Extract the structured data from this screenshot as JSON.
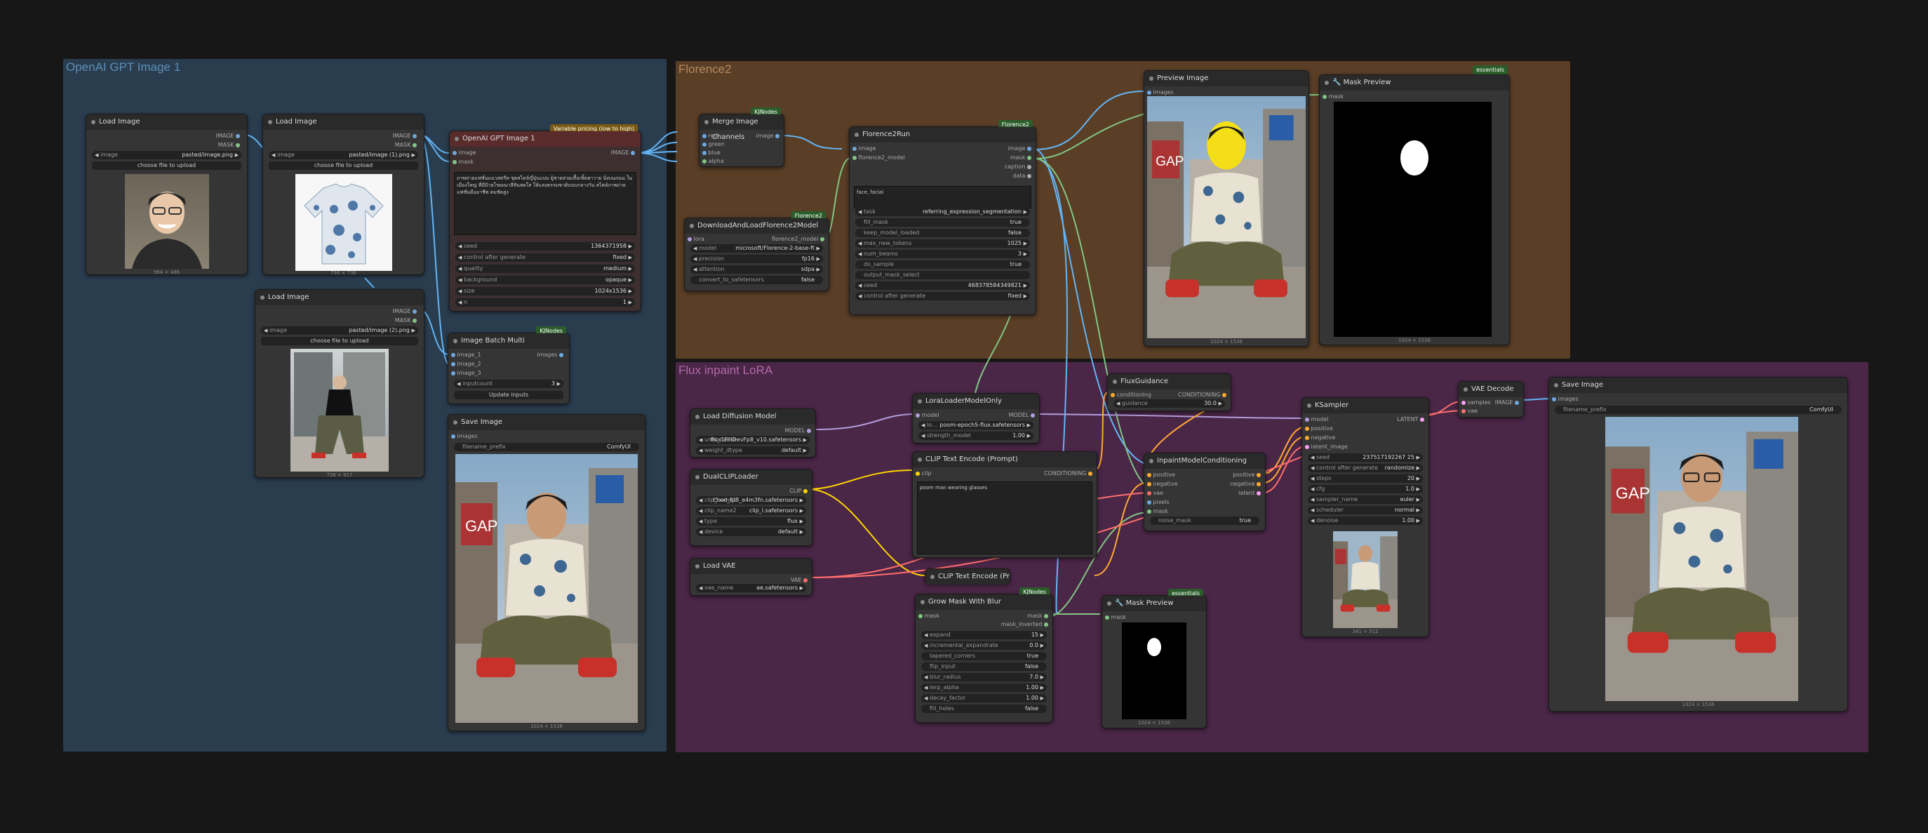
{
  "groups": {
    "openai": "OpenAI GPT Image 1",
    "florence": "Florence2",
    "flux": "Flux inpaint LoRA"
  },
  "colors": {
    "group_openai": "#2a3d4f",
    "group_florence": "#5a3e26",
    "group_flux": "#4a2647",
    "wire_image": "#64b5f6",
    "wire_mask": "#81c784",
    "wire_clip": "#ffd500",
    "wire_conditioning": "#ffa931",
    "wire_vae": "#ff6e6e",
    "wire_model": "#b39ddb"
  },
  "badges": {
    "kjnodes": "KJNodes",
    "florence2": "Florence2",
    "essentials": "essentials",
    "pricing": "Variable pricing (low to high)"
  },
  "load1": {
    "title": "Load Image",
    "out_image": "IMAGE",
    "out_mask": "MASK",
    "image_label": "image",
    "image_value": "pasted/image.png",
    "upload": "choose file to upload",
    "dims": "964 × 486"
  },
  "load2": {
    "title": "Load Image",
    "out_image": "IMAGE",
    "out_mask": "MASK",
    "image_label": "image",
    "image_value": "pasted/image (1).png",
    "upload": "choose file to upload",
    "dims": "736 × 736"
  },
  "load3": {
    "title": "Load Image",
    "out_image": "IMAGE",
    "out_mask": "MASK",
    "image_label": "image",
    "image_value": "pasted/image (2).png",
    "upload": "choose file to upload",
    "dims": "736 × 917"
  },
  "gpt": {
    "title": "OpenAI GPT Image 1",
    "in_image": "image",
    "in_mask": "mask",
    "out_image": "IMAGE",
    "prompt": "ภาพถ่ายแฟชั่นแนวสตรีท ชุดสไตล์ญี่ปุ่นแบบ ผู้ชายสวมเสื้อเชิ้ตฮาวาย นั่งบนถนน ในเมืองใหญ่ ที่มีป้ายโฆษณาสีสันสดใส ให้แสงธรรมชาติแบบกลางวัน สไตล์ภาพถ่ายแฟชั่นมืออาชีพ คมชัดสูง",
    "seed_label": "seed",
    "seed": "1364371958",
    "cag_label": "control after generate",
    "cag": "fixed",
    "quality_label": "quality",
    "quality": "medium",
    "bg_label": "background",
    "bg": "opaque",
    "size_label": "size",
    "size": "1024x1536",
    "n_label": "n",
    "n": "1"
  },
  "batch": {
    "title": "Image Batch Multi",
    "in1": "image_1",
    "in2": "image_2",
    "in3": "image_3",
    "out": "images",
    "w_label": "inputcount",
    "w_value": "3",
    "button": "Update inputs"
  },
  "save1": {
    "title": "Save Image",
    "in": "images",
    "prefix_label": "filename_prefix",
    "prefix": "ComfyUI",
    "dims": "1024 × 1536"
  },
  "merge": {
    "title": "Merge Image Channels",
    "in": [
      "red",
      "green",
      "blue",
      "alpha"
    ],
    "out": "image"
  },
  "dl": {
    "title": "DownloadAndLoadFlorence2Model",
    "in": "lora",
    "out": "florence2_model",
    "model_label": "model",
    "model": "microsoft/Florence-2-base-ft",
    "prec_label": "precision",
    "prec": "fp16",
    "attn_label": "attention",
    "attn": "sdpa",
    "conv_label": "convert_to_safetensors",
    "conv": "false"
  },
  "f2run": {
    "title": "Florence2Run",
    "in_image": "image",
    "in_model": "florence2_model",
    "outs": [
      "image",
      "mask",
      "caption",
      "data"
    ],
    "text": "face, facial",
    "w": [
      [
        "task",
        "referring_expression_segmentation"
      ],
      [
        "fill_mask",
        "true"
      ],
      [
        "keep_model_loaded",
        "false"
      ],
      [
        "max_new_tokens",
        "1025"
      ],
      [
        "num_beams",
        "3"
      ],
      [
        "do_sample",
        "true"
      ],
      [
        "output_mask_select",
        ""
      ],
      [
        "seed",
        "468378584349821"
      ],
      [
        "control after generate",
        "fixed"
      ]
    ]
  },
  "preview": {
    "title": "Preview Image",
    "in": "images",
    "dims": "1024 × 1536"
  },
  "maskprev1": {
    "title": "🔧 Mask Preview",
    "in": "mask",
    "dims": "1024 × 1536"
  },
  "ldm": {
    "title": "Load Diffusion Model",
    "out": "MODEL",
    "unet_label": "unet_name",
    "unet": "flux1FillDevFp8_v10.safetensors",
    "wd_label": "weight_dtype",
    "wd": "default"
  },
  "dclip": {
    "title": "DualCLIPLoader",
    "out": "CLIP",
    "c1_label": "clip_name1",
    "c1": "t5xxl_fp8_e4m3fn.safetensors",
    "c2_label": "clip_name2",
    "c2": "clip_l.safetensors",
    "type_label": "type",
    "type": "flux",
    "dev_label": "device",
    "dev": "default"
  },
  "lvae": {
    "title": "Load VAE",
    "out": "VAE",
    "vae_label": "vae_name",
    "vae": "ae.safetensors"
  },
  "lora": {
    "title": "LoraLoaderModelOnly",
    "in": "model",
    "out": "MODEL",
    "name_label": "lo...",
    "name": "poom-epoch5-flux.safetensors",
    "str_label": "strength_model",
    "str": "1.00"
  },
  "clipenc": {
    "title": "CLIP Text Encode (Prompt)",
    "in": "clip",
    "out": "CONDITIONING",
    "text": "poom man wearing glasses"
  },
  "clipenc2": {
    "title": "CLIP Text Encode (Pr"
  },
  "fluxg": {
    "title": "FluxGuidance",
    "in": "conditioning",
    "out": "CONDITIONING",
    "g_label": "guidance",
    "g": "30.0"
  },
  "inpc": {
    "title": "InpaintModelConditioning",
    "ins": [
      "positive",
      "negative",
      "vae",
      "pixels",
      "mask"
    ],
    "outs": [
      "positive",
      "negative",
      "latent"
    ],
    "nm_label": "noise_mask",
    "nm": "true"
  },
  "ksampler": {
    "title": "KSampler",
    "ins": [
      "model",
      "positive",
      "negative",
      "latent_image"
    ],
    "out": "LATENT",
    "w": [
      [
        "seed",
        "237517192267 25"
      ],
      [
        "control after generate",
        "randomize"
      ],
      [
        "steps",
        "20"
      ],
      [
        "cfg",
        "1.0"
      ],
      [
        "sampler_name",
        "euler"
      ],
      [
        "scheduler",
        "normal"
      ],
      [
        "denoise",
        "1.00"
      ]
    ],
    "dims": "341 × 512"
  },
  "vaedec": {
    "title": "VAE Decode",
    "ins": [
      "samples",
      "vae"
    ],
    "out": "IMAGE"
  },
  "save2": {
    "title": "Save Image",
    "in": "images",
    "prefix_label": "filename_prefix",
    "prefix": "ComfyUI",
    "dims": "1024 × 1536"
  },
  "grow": {
    "title": "Grow Mask With Blur",
    "in": "mask",
    "outs": [
      "mask",
      "mask_inverted"
    ],
    "w": [
      [
        "expand",
        "15"
      ],
      [
        "incremental_expandrate",
        "0.0"
      ],
      [
        "tapered_corners",
        "true"
      ],
      [
        "flip_input",
        "false"
      ],
      [
        "blur_radius",
        "7.0"
      ],
      [
        "lerp_alpha",
        "1.00"
      ],
      [
        "decay_factor",
        "1.00"
      ],
      [
        "fill_holes",
        "false"
      ]
    ]
  },
  "maskprev2": {
    "title": "🔧 Mask Preview",
    "in": "mask",
    "dims": "1024 × 1536"
  }
}
